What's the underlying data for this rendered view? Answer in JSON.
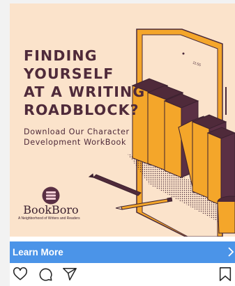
{
  "ad": {
    "headline": [
      "FINDING",
      "YOURSELF",
      "AT A WRITING",
      "ROADBLOCK?"
    ],
    "subline": [
      "Download Our Character",
      "Development WorkBook"
    ],
    "tablet_status": "11:55",
    "brand_name": "BookBoro",
    "brand_tagline": "A Neighborhood of Writers and Readers"
  },
  "cta": {
    "label": "Learn More",
    "chevron_icon": "chevron-right-icon"
  },
  "actions": {
    "icons": [
      "heart-icon",
      "comment-icon",
      "share-icon",
      "bookmark-icon"
    ]
  },
  "colors": {
    "ad_background": "#fbe3cb",
    "headline": "#4f2a3a",
    "accent_orange": "#f4a62a",
    "cta_blue": "#4b94e8"
  }
}
